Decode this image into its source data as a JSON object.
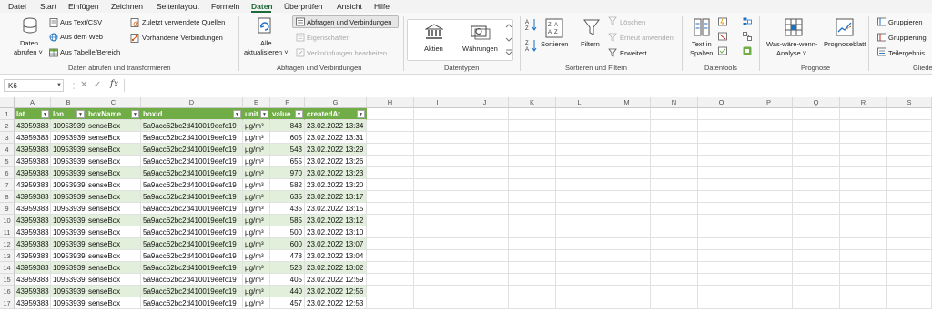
{
  "menu": {
    "tabs": [
      "Datei",
      "Start",
      "Einfügen",
      "Zeichnen",
      "Seitenlayout",
      "Formeln",
      "Daten",
      "Überprüfen",
      "Ansicht",
      "Hilfe"
    ],
    "active": "Daten"
  },
  "ribbon": {
    "get_data": {
      "data_label_1": "Daten",
      "data_label_2": "abrufen ˅",
      "from_text_csv": "Aus Text/CSV",
      "from_web": "Aus dem Web",
      "from_table": "Aus Tabelle/Bereich",
      "recent_sources": "Zuletzt verwendete Quellen",
      "existing_connections": "Vorhandene Verbindungen",
      "group_label": "Daten abrufen und transformieren"
    },
    "queries": {
      "refresh_label_1": "Alle",
      "refresh_label_2": "aktualisieren ˅",
      "queries_connections": "Abfragen und Verbindungen",
      "properties": "Eigenschaften",
      "edit_links": "Verknüpfungen bearbeiten",
      "group_label": "Abfragen und Verbindungen"
    },
    "data_types": {
      "stocks": "Aktien",
      "currencies": "Währungen",
      "group_label": "Datentypen"
    },
    "sort_filter": {
      "sort": "Sortieren",
      "filter": "Filtern",
      "clear": "Löschen",
      "reapply": "Erneut anwenden",
      "advanced": "Erweitert",
      "group_label": "Sortieren und Filtern"
    },
    "data_tools": {
      "text_to_columns_1": "Text in",
      "text_to_columns_2": "Spalten",
      "group_label": "Datentools"
    },
    "forecast": {
      "what_if_1": "Was-wäre-wenn-",
      "what_if_2": "Analyse ˅",
      "forecast_sheet": "Prognoseblatt",
      "group_label": "Prognose"
    },
    "outline": {
      "group": "Gruppieren",
      "ungroup": "Gruppierung",
      "subtotal": "Teilergebnis",
      "group_label": "Gliede"
    }
  },
  "formula_bar": {
    "name_box": "K6",
    "fx": "fx",
    "value": ""
  },
  "sheet": {
    "columns": [
      "A",
      "B",
      "C",
      "D",
      "E",
      "F",
      "G",
      "H",
      "I",
      "J",
      "K",
      "L",
      "M",
      "N",
      "O",
      "P",
      "Q",
      "R",
      "S"
    ],
    "table_headers": [
      "lat",
      "lon",
      "boxName",
      "boxId",
      "unit",
      "value",
      "createdAt"
    ],
    "rows": [
      [
        "43959383",
        "10953939",
        "senseBox",
        "5a9acc62bc2d410019eefc19",
        "µg/m³",
        "843",
        "23.02.2022 13:34"
      ],
      [
        "43959383",
        "10953939",
        "senseBox",
        "5a9acc62bc2d410019eefc19",
        "µg/m³",
        "605",
        "23.02.2022 13:31"
      ],
      [
        "43959383",
        "10953939",
        "senseBox",
        "5a9acc62bc2d410019eefc19",
        "µg/m³",
        "543",
        "23.02.2022 13:29"
      ],
      [
        "43959383",
        "10953939",
        "senseBox",
        "5a9acc62bc2d410019eefc19",
        "µg/m³",
        "655",
        "23.02.2022 13:26"
      ],
      [
        "43959383",
        "10953939",
        "senseBox",
        "5a9acc62bc2d410019eefc19",
        "µg/m³",
        "970",
        "23.02.2022 13:23"
      ],
      [
        "43959383",
        "10953939",
        "senseBox",
        "5a9acc62bc2d410019eefc19",
        "µg/m³",
        "582",
        "23.02.2022 13:20"
      ],
      [
        "43959383",
        "10953939",
        "senseBox",
        "5a9acc62bc2d410019eefc19",
        "µg/m³",
        "635",
        "23.02.2022 13:17"
      ],
      [
        "43959383",
        "10953939",
        "senseBox",
        "5a9acc62bc2d410019eefc19",
        "µg/m³",
        "435",
        "23.02.2022 13:15"
      ],
      [
        "43959383",
        "10953939",
        "senseBox",
        "5a9acc62bc2d410019eefc19",
        "µg/m³",
        "585",
        "23.02.2022 13:12"
      ],
      [
        "43959383",
        "10953939",
        "senseBox",
        "5a9acc62bc2d410019eefc19",
        "µg/m³",
        "500",
        "23.02.2022 13:10"
      ],
      [
        "43959383",
        "10953939",
        "senseBox",
        "5a9acc62bc2d410019eefc19",
        "µg/m³",
        "600",
        "23.02.2022 13:07"
      ],
      [
        "43959383",
        "10953939",
        "senseBox",
        "5a9acc62bc2d410019eefc19",
        "µg/m³",
        "478",
        "23.02.2022 13:04"
      ],
      [
        "43959383",
        "10953939",
        "senseBox",
        "5a9acc62bc2d410019eefc19",
        "µg/m³",
        "528",
        "23.02.2022 13:02"
      ],
      [
        "43959383",
        "10953939",
        "senseBox",
        "5a9acc62bc2d410019eefc19",
        "µg/m³",
        "405",
        "23.02.2022 12:59"
      ],
      [
        "43959383",
        "10953939",
        "senseBox",
        "5a9acc62bc2d410019eefc19",
        "µg/m³",
        "440",
        "23.02.2022 12:56"
      ],
      [
        "43959383",
        "10953939",
        "senseBox",
        "5a9acc62bc2d410019eefc19",
        "µg/m³",
        "457",
        "23.02.2022 12:53"
      ]
    ],
    "header_color": "#70ad47",
    "band_color": "#e2efda"
  }
}
